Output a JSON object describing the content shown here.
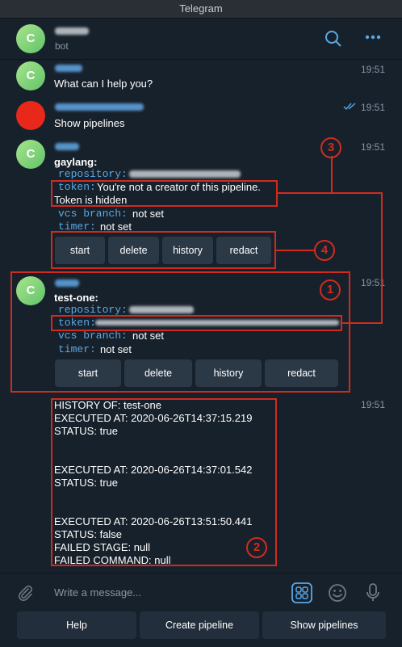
{
  "window": {
    "title": "Telegram"
  },
  "header": {
    "avatar_letter": "C",
    "status": "bot"
  },
  "messages": [
    {
      "avatar_letter": "C",
      "time": "19:51",
      "text": "What can I help you?"
    },
    {
      "time": "19:51",
      "text": "Show pipelines"
    },
    {
      "avatar_letter": "C",
      "time": "19:51",
      "pipeline_name": "gaylang:",
      "repository_label": "repository:",
      "token_label": "token:",
      "token_note_1": "You're not a creator of this pipeline.",
      "token_note_2": "Token is hidden",
      "vcs_branch_label": "vcs branch:",
      "vcs_branch_value": "not set",
      "timer_label": "timer:",
      "timer_value": "not set",
      "buttons": [
        "start",
        "delete",
        "history",
        "redact"
      ]
    },
    {
      "avatar_letter": "C",
      "time": "19:51",
      "pipeline_name": "test-one:",
      "repository_label": "repository:",
      "token_label": "token:",
      "vcs_branch_label": "vcs branch:",
      "vcs_branch_value": "not set",
      "timer_label": "timer:",
      "timer_value": "not set",
      "buttons": [
        "start",
        "delete",
        "history",
        "redact"
      ]
    },
    {
      "time": "19:51",
      "lines": [
        "HISTORY OF: test-one",
        "EXECUTED AT: 2020-06-26T14:37:15.219",
        "STATUS: true",
        "EXECUTED AT: 2020-06-26T14:37:01.542",
        "STATUS: true",
        "EXECUTED AT: 2020-06-26T13:51:50.441",
        "STATUS: false",
        "FAILED STAGE: null",
        "FAILED COMMAND: null"
      ]
    }
  ],
  "annotations": [
    "1",
    "2",
    "3",
    "4"
  ],
  "composer": {
    "placeholder": "Write a message..."
  },
  "keyboard": [
    "Help",
    "Create pipeline",
    "Show pipelines"
  ],
  "colors": {
    "background": "#17212b",
    "button": "#2b3947",
    "accent": "#5aa8e6",
    "annotation": "#d12b1f"
  }
}
